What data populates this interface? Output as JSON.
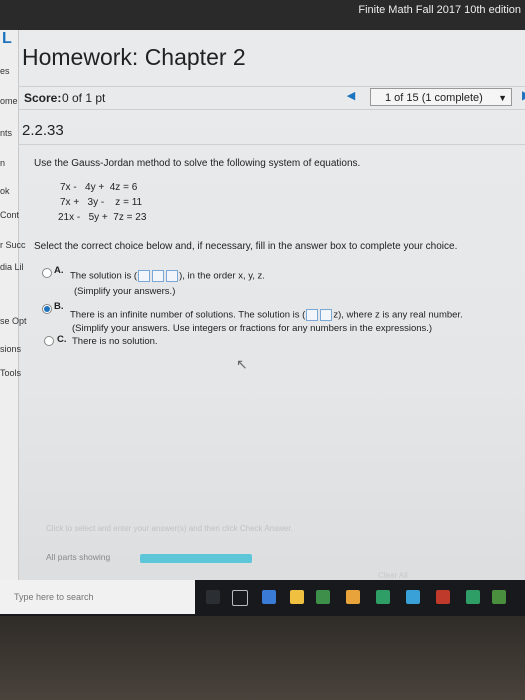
{
  "window": {
    "course_title": "Finite Math Fall 2017 10th edition"
  },
  "sidebar": {
    "logo": "L",
    "items": [
      "es",
      "ome",
      "nts",
      "n",
      "ok",
      "Cont",
      "r Succ",
      "dia Lil",
      "se Opt",
      "sions",
      "Tools"
    ]
  },
  "header": {
    "title": "Homework: Chapter 2",
    "score_label": "Score:",
    "score_value": "0 of 1 pt",
    "progress": "1 of 15 (1 complete)",
    "question_number": "2.2.33"
  },
  "question": {
    "prompt": "Use the Gauss-Jordan method to solve the following system of equations.",
    "equations": [
      "7x -   4y +  4z = 6",
      "7x +   3y -    z = 11",
      "21x -   5y +  7z = 23"
    ],
    "instruction": "Select the correct choice below and, if necessary, fill in the answer box to complete your choice."
  },
  "choices": [
    {
      "letter": "A.",
      "text1": "The solution is (",
      "text2": "), in the order x, y, z.",
      "sub": "(Simplify your answers.)",
      "selected": false
    },
    {
      "letter": "B.",
      "text1": "There is an infinite number of solutions. The solution is (",
      "text2": "z), where z is any real number.",
      "sub": "(Simplify your answers. Use integers or fractions for any numbers in the expressions.)",
      "selected": true
    },
    {
      "letter": "C.",
      "text1": "There is no solution.",
      "selected": false
    }
  ],
  "footer": {
    "hint": "Click to select and enter your answer(s) and then click Check Answer.",
    "parts_label": "All parts showing",
    "clear_all": "Clear All"
  },
  "taskbar": {
    "search_placeholder": "Type here to search"
  },
  "colors": {
    "accent": "#1e73be",
    "progress_bar": "#5dc7d9"
  }
}
